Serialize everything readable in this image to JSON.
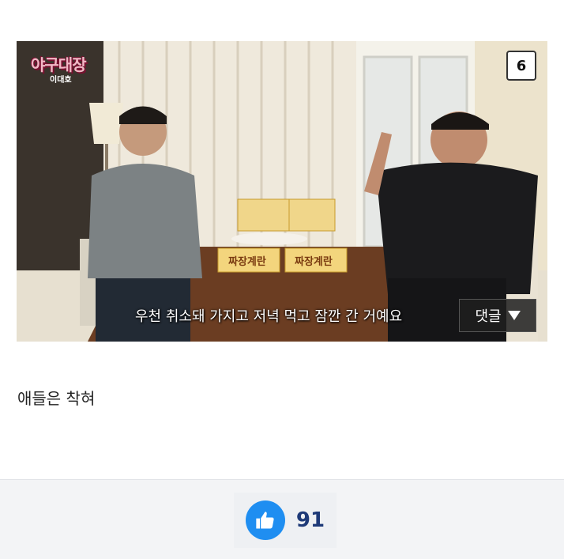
{
  "video": {
    "channel_logo": "야구대장",
    "channel_sub": "이대호",
    "page_badge": "6",
    "subtitle": "우천 취소돼 가지고 저녁 먹고 잠깐 간 거예요",
    "comments_button": "댓글",
    "product_label": "짜장계란"
  },
  "post": {
    "text": "애들은 착혀"
  },
  "reactions": {
    "like_icon": "thumbs-up-icon",
    "like_count": "91",
    "like_color": "#1f8ef1"
  }
}
